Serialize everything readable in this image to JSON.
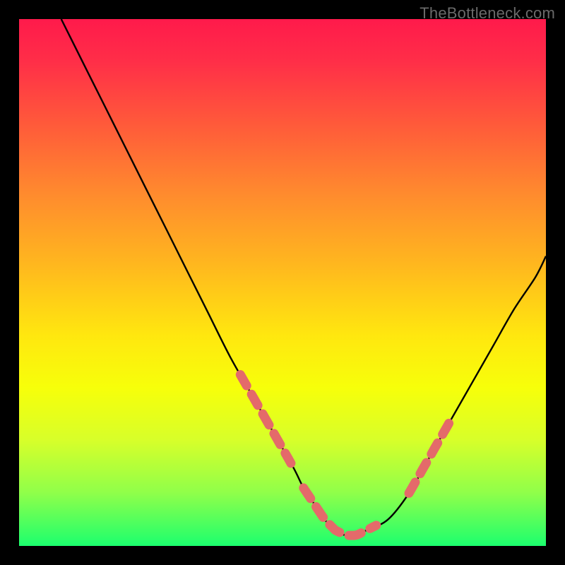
{
  "watermark": "TheBottleneck.com",
  "colors": {
    "background": "#000000",
    "gradient_top": "#ff1a4b",
    "gradient_bottom": "#1cff6e",
    "curve": "#000000",
    "markers": "#e46a6a"
  },
  "chart_data": {
    "type": "line",
    "title": "",
    "xlabel": "",
    "ylabel": "",
    "xlim": [
      0,
      100
    ],
    "ylim": [
      0,
      100
    ],
    "series": [
      {
        "name": "bottleneck-curve",
        "x": [
          8,
          12,
          16,
          20,
          24,
          28,
          32,
          36,
          40,
          44,
          48,
          52,
          54,
          56,
          58,
          60,
          62,
          64,
          66,
          70,
          74,
          78,
          82,
          86,
          90,
          94,
          98,
          100
        ],
        "y": [
          100,
          92,
          84,
          76,
          68,
          60,
          52,
          44,
          36,
          29,
          22,
          15,
          11,
          8,
          5,
          3,
          2,
          2,
          3,
          5,
          10,
          17,
          24,
          31,
          38,
          45,
          51,
          55
        ]
      }
    ],
    "markers": {
      "name": "highlighted-segments",
      "segments": [
        {
          "x_start": 42,
          "x_end": 52
        },
        {
          "x_start": 54,
          "x_end": 68
        },
        {
          "x_start": 74,
          "x_end": 82
        }
      ]
    }
  }
}
